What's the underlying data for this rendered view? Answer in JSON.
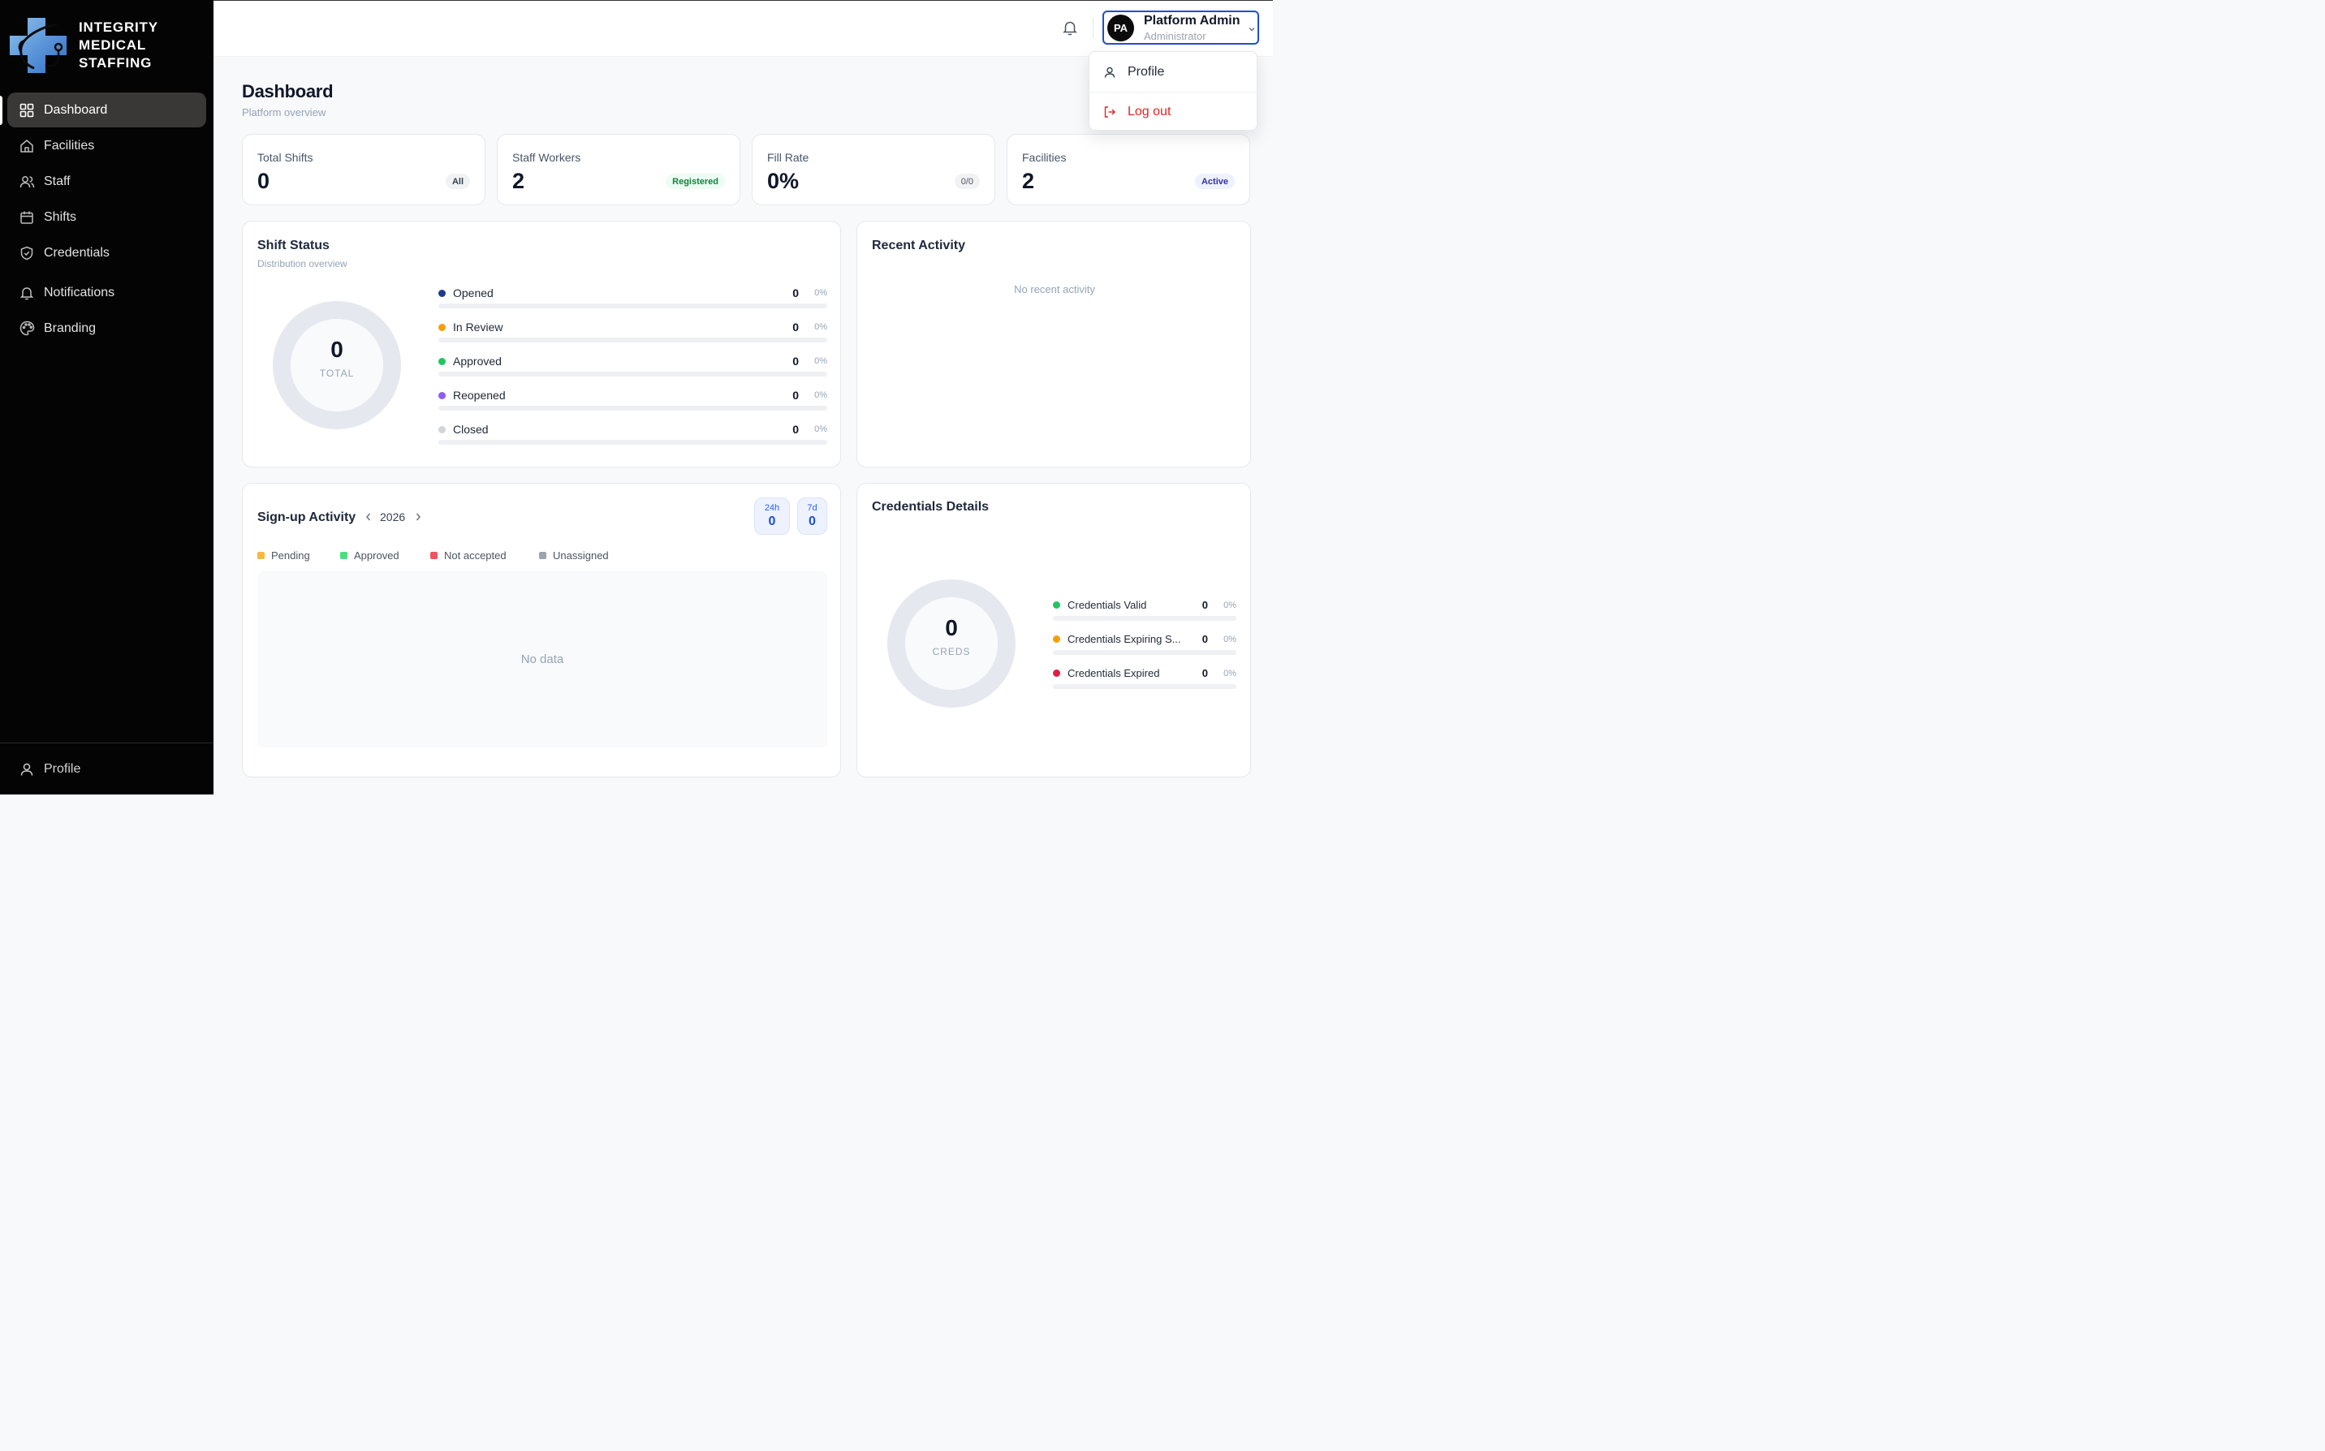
{
  "brand": {
    "lines": [
      "INTEGRITY",
      "MEDICAL",
      "STAFFING"
    ]
  },
  "sidebar": {
    "items": [
      {
        "label": "Dashboard",
        "icon": "grid-icon"
      },
      {
        "label": "Facilities",
        "icon": "home-icon"
      },
      {
        "label": "Staff",
        "icon": "users-icon"
      },
      {
        "label": "Shifts",
        "icon": "calendar-icon"
      },
      {
        "label": "Credentials",
        "icon": "shield-icon"
      },
      {
        "label": "Notifications",
        "icon": "bell-icon"
      },
      {
        "label": "Branding",
        "icon": "palette-icon"
      }
    ],
    "footer_label": "Profile"
  },
  "header": {
    "avatar_initials": "PA",
    "user_name": "Platform Admin",
    "user_role": "Administrator"
  },
  "user_menu": {
    "profile": "Profile",
    "logout": "Log out"
  },
  "page": {
    "title": "Dashboard",
    "subtitle": "Platform overview"
  },
  "stats": [
    {
      "label": "Total Shifts",
      "value": "0",
      "badge": "All"
    },
    {
      "label": "Staff Workers",
      "value": "2",
      "badge": "Registered"
    },
    {
      "label": "Fill Rate",
      "value": "0%",
      "badge": "0/0"
    },
    {
      "label": "Facilities",
      "value": "2",
      "badge": "Active"
    }
  ],
  "shift_status": {
    "title": "Shift Status",
    "subtitle": "Distribution overview",
    "total": "0",
    "total_label": "TOTAL",
    "rows": [
      {
        "label": "Opened",
        "value": "0",
        "pct": "0%",
        "color": "#1e3a8a"
      },
      {
        "label": "In Review",
        "value": "0",
        "pct": "0%",
        "color": "#f59e0b"
      },
      {
        "label": "Approved",
        "value": "0",
        "pct": "0%",
        "color": "#22c55e"
      },
      {
        "label": "Reopened",
        "value": "0",
        "pct": "0%",
        "color": "#8b5cf6"
      },
      {
        "label": "Closed",
        "value": "0",
        "pct": "0%",
        "color": "#d1d5db"
      }
    ]
  },
  "recent_activity": {
    "title": "Recent Activity",
    "empty": "No recent activity"
  },
  "signup": {
    "title": "Sign-up Activity",
    "year": "2026",
    "chips": [
      {
        "label": "24h",
        "value": "0"
      },
      {
        "label": "7d",
        "value": "0"
      }
    ],
    "legend": [
      {
        "label": "Pending",
        "color": "#f5b942"
      },
      {
        "label": "Approved",
        "color": "#4ade80"
      },
      {
        "label": "Not accepted",
        "color": "#f05261"
      },
      {
        "label": "Unassigned",
        "color": "#9ca3af"
      }
    ],
    "empty": "No data"
  },
  "credentials": {
    "title": "Credentials Details",
    "total": "0",
    "total_label": "CREDS",
    "rows": [
      {
        "label": "Credentials Valid",
        "value": "0",
        "pct": "0%",
        "color": "#22c55e"
      },
      {
        "label": "Credentials Expiring S...",
        "value": "0",
        "pct": "0%",
        "color": "#f59e0b"
      },
      {
        "label": "Credentials Expired",
        "value": "0",
        "pct": "0%",
        "color": "#e11d48"
      }
    ]
  },
  "colors": {
    "accent": "#1d4ed8",
    "sidebar_bg": "#040404",
    "danger": "#dc2626"
  }
}
